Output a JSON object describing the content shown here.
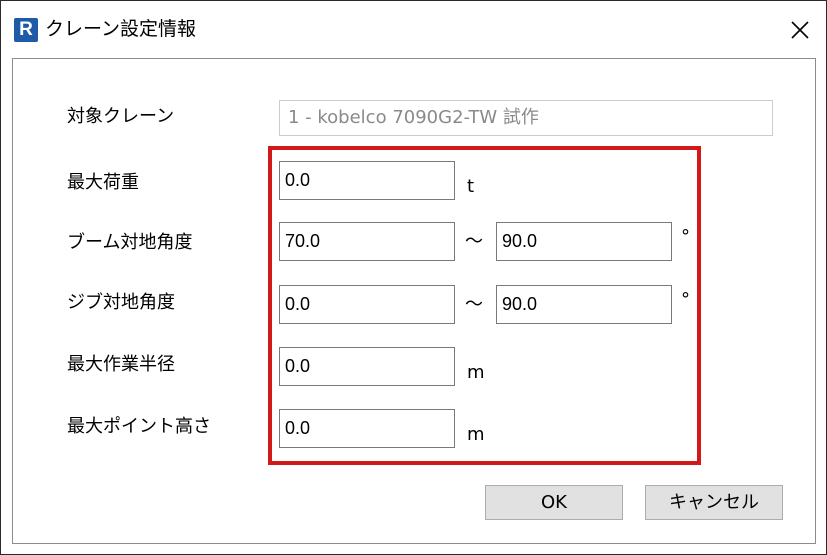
{
  "window": {
    "title": "クレーン設定情報",
    "app_icon_letter": "R",
    "accent_color": "#d21818"
  },
  "form": {
    "target_crane": {
      "label": "対象クレーン",
      "value": "1 - kobelco 7090G2-TW 試作"
    },
    "max_load": {
      "label": "最大荷重",
      "value": "0.0",
      "unit": "t"
    },
    "boom_angle": {
      "label": "ブーム対地角度",
      "min": "70.0",
      "sep": "～",
      "max": "90.0",
      "unit": "°"
    },
    "jib_angle": {
      "label": "ジブ対地角度",
      "min": "0.0",
      "sep": "～",
      "max": "90.0",
      "unit": "°"
    },
    "max_radius": {
      "label": "最大作業半径",
      "value": "0.0",
      "unit": "m"
    },
    "max_height": {
      "label": "最大ポイント高さ",
      "value": "0.0",
      "unit": "m"
    }
  },
  "buttons": {
    "ok": "OK",
    "cancel": "キャンセル"
  }
}
